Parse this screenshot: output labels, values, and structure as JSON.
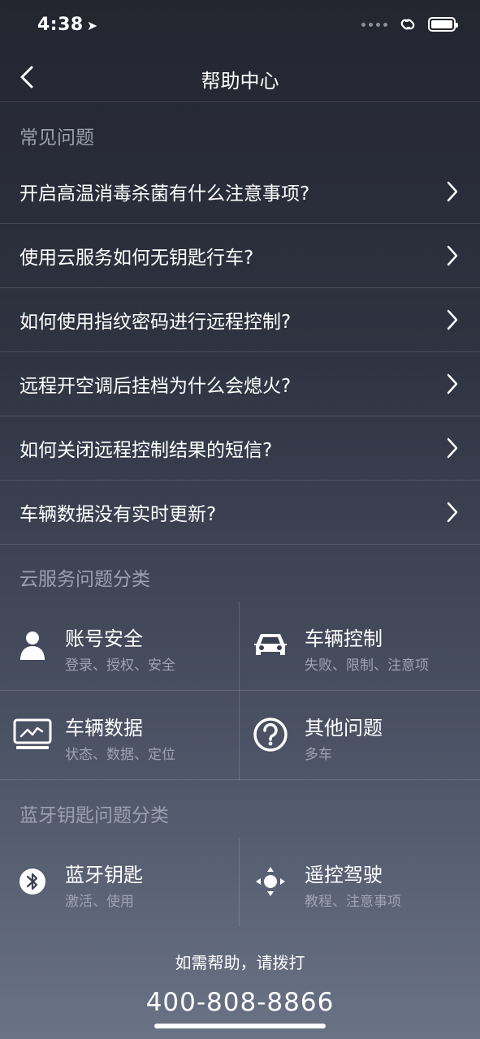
{
  "status_bar": {
    "time": "4:38"
  },
  "nav": {
    "title": "帮助中心"
  },
  "faq": {
    "section_title": "常见问题",
    "items": [
      {
        "question": "开启高温消毒杀菌有什么注意事项?"
      },
      {
        "question": "使用云服务如何无钥匙行车?"
      },
      {
        "question": "如何使用指纹密码进行远程控制?"
      },
      {
        "question": "远程开空调后挂档为什么会熄火?"
      },
      {
        "question": "如何关闭远程控制结果的短信?"
      },
      {
        "question": "车辆数据没有实时更新?"
      }
    ]
  },
  "cloud": {
    "section_title": "云服务问题分类",
    "items": [
      {
        "name": "账号安全",
        "sub": "登录、授权、安全",
        "icon": "user-icon"
      },
      {
        "name": "车辆控制",
        "sub": "失败、限制、注意项",
        "icon": "car-icon"
      },
      {
        "name": "车辆数据",
        "sub": "状态、数据、定位",
        "icon": "monitor-icon"
      },
      {
        "name": "其他问题",
        "sub": "多车",
        "icon": "question-icon"
      }
    ]
  },
  "bluetooth": {
    "section_title": "蓝牙钥匙问题分类",
    "items": [
      {
        "name": "蓝牙钥匙",
        "sub": "激活、使用",
        "icon": "bluetooth-icon"
      },
      {
        "name": "遥控驾驶",
        "sub": "教程、注意事项",
        "icon": "remote-drive-icon"
      }
    ]
  },
  "footer": {
    "help_text": "如需帮助，请拨打",
    "phone": "400-808-8866"
  }
}
